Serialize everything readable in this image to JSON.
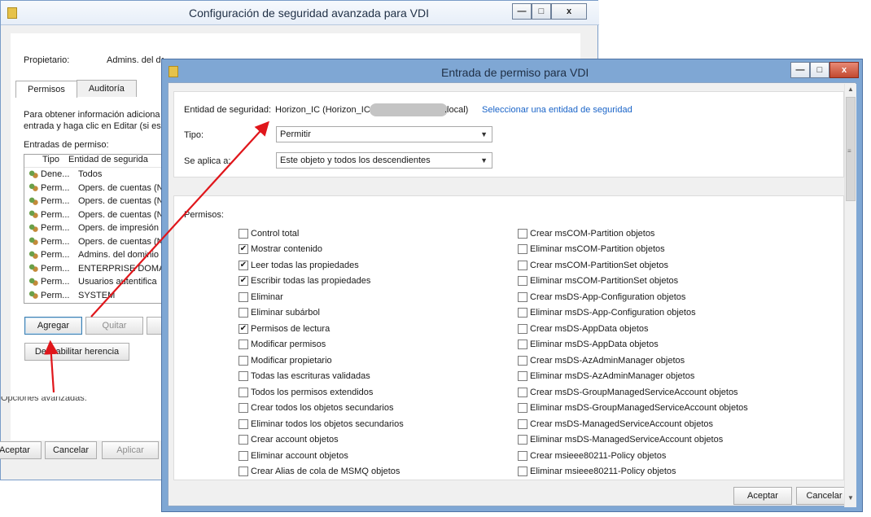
{
  "back_window": {
    "title": "Configuración de seguridad avanzada para VDI",
    "owner_label": "Propietario:",
    "owner_value": "Admins. del dominio (NCOBAFORMACION\\Admins. del dominio)",
    "tabs": [
      "Permisos",
      "Auditoría"
    ],
    "info_line1": "Para obtener información adiciona",
    "info_line2": "entrada y haga clic en Editar (si est",
    "entries_label": "Entradas de permiso:",
    "columns": {
      "type": "Tipo",
      "entity": "Entidad de segurida"
    },
    "entries": [
      {
        "type": "Dene...",
        "entity": "Todos"
      },
      {
        "type": "Perm...",
        "entity": "Opers. de cuentas (N"
      },
      {
        "type": "Perm...",
        "entity": "Opers. de cuentas (N"
      },
      {
        "type": "Perm...",
        "entity": "Opers. de cuentas (N"
      },
      {
        "type": "Perm...",
        "entity": "Opers. de impresión"
      },
      {
        "type": "Perm...",
        "entity": "Opers. de cuentas (N"
      },
      {
        "type": "Perm...",
        "entity": "Admins. del dominio"
      },
      {
        "type": "Perm...",
        "entity": "ENTERPRISE DOMAI"
      },
      {
        "type": "Perm...",
        "entity": "Usuarios autentifica"
      },
      {
        "type": "Perm...",
        "entity": "SYSTEM"
      }
    ],
    "add_button": "Agregar",
    "remove_button": "Quitar",
    "disable_inheritance_button": "Deshabilitar herencia",
    "advanced_options": "Opciones avanzadas:",
    "accept_button": "Aceptar",
    "cancel_button": "Cancelar",
    "apply_button": "Aplicar"
  },
  "dialog": {
    "title": "Entrada de permiso para VDI",
    "principal_label": "Entidad de seguridad:",
    "principal_value_start": "Horizon_IC (Horizon_IC@",
    "principal_value_end": ".local)",
    "select_principal_link": "Seleccionar una entidad de seguridad",
    "type_label": "Tipo:",
    "type_value": "Permitir",
    "applies_label": "Se aplica a:",
    "applies_value": "Este objeto y todos los descendientes",
    "permissions_label": "Permisos:",
    "left_permissions": [
      {
        "label": "Control total",
        "checked": false
      },
      {
        "label": "Mostrar contenido",
        "checked": true
      },
      {
        "label": "Leer todas las propiedades",
        "checked": true
      },
      {
        "label": "Escribir todas las propiedades",
        "checked": true
      },
      {
        "label": "Eliminar",
        "checked": false
      },
      {
        "label": "Eliminar subárbol",
        "checked": false
      },
      {
        "label": "Permisos de lectura",
        "checked": true
      },
      {
        "label": "Modificar permisos",
        "checked": false
      },
      {
        "label": "Modificar propietario",
        "checked": false
      },
      {
        "label": "Todas las escrituras validadas",
        "checked": false
      },
      {
        "label": "Todos los permisos extendidos",
        "checked": false
      },
      {
        "label": "Crear todos los objetos secundarios",
        "checked": false
      },
      {
        "label": "Eliminar todos los objetos secundarios",
        "checked": false
      },
      {
        "label": "Crear account objetos",
        "checked": false
      },
      {
        "label": "Eliminar account objetos",
        "checked": false
      },
      {
        "label": "Crear Alias de cola de MSMQ objetos",
        "checked": false
      }
    ],
    "right_permissions": [
      {
        "label": "Crear msCOM-Partition objetos",
        "checked": false
      },
      {
        "label": "Eliminar msCOM-Partition objetos",
        "checked": false
      },
      {
        "label": "Crear msCOM-PartitionSet objetos",
        "checked": false
      },
      {
        "label": "Eliminar msCOM-PartitionSet objetos",
        "checked": false
      },
      {
        "label": "Crear msDS-App-Configuration objetos",
        "checked": false
      },
      {
        "label": "Eliminar msDS-App-Configuration objetos",
        "checked": false
      },
      {
        "label": "Crear msDS-AppData objetos",
        "checked": false
      },
      {
        "label": "Eliminar msDS-AppData objetos",
        "checked": false
      },
      {
        "label": "Crear msDS-AzAdminManager objetos",
        "checked": false
      },
      {
        "label": "Eliminar msDS-AzAdminManager objetos",
        "checked": false
      },
      {
        "label": "Crear msDS-GroupManagedServiceAccount objetos",
        "checked": false
      },
      {
        "label": "Eliminar msDS-GroupManagedServiceAccount objetos",
        "checked": false
      },
      {
        "label": "Crear msDS-ManagedServiceAccount objetos",
        "checked": false
      },
      {
        "label": "Eliminar msDS-ManagedServiceAccount objetos",
        "checked": false
      },
      {
        "label": "Crear msieee80211-Policy objetos",
        "checked": false
      },
      {
        "label": "Eliminar msieee80211-Policy objetos",
        "checked": false
      }
    ],
    "accept_button": "Aceptar",
    "cancel_button": "Cancelar"
  },
  "window_controls": {
    "minimize": "—",
    "maximize": "□",
    "close": "x"
  },
  "colors": {
    "link": "#1a64c8",
    "annotation_arrow": "#e0161b",
    "titlebar_front": "#7fa7d4"
  }
}
